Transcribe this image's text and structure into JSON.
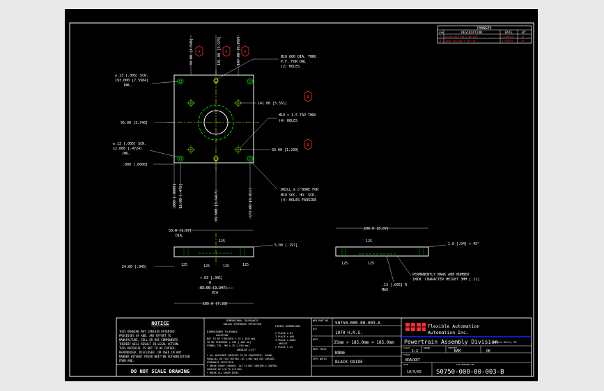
{
  "changes": {
    "title": "CHANGES",
    "headers": [
      "SYM",
      "DESCRIPTION",
      "DATE",
      "BY"
    ],
    "rows": [
      [
        "1",
        "REVISE HOLE DIM & ADD NOTE",
        "11/09/05",
        "JR"
      ],
      [
        "2",
        "ADDED BALLOONS & TEXT ON",
        "11/09/05",
        "JR"
      ]
    ]
  },
  "top_view": {
    "dim_v_left": "39.00 [1.536]",
    "dim_v_mid": "101.00 [3.976]",
    "dim_v_right": "147.00 [5.787]",
    "balloon_a": "A",
    "balloon_b": "B",
    "note_hole_1": "Ø10.000 DIA. THRU",
    "note_hole_2": "P.F. FOR DWL",
    "note_hole_3": "(2) HOLES",
    "bolt_scr_1": "±.13 [.005] SCR.",
    "bolt_scr_2": "193.000 [7.5984]",
    "bolt_scr_3": "DWL.",
    "dim_141": "141.00 [5.551]",
    "tap_1": "M10 × 1.5 TAP THRU",
    "tap_2": "(4) HOLES",
    "dim_95": "95.00 [3.740]",
    "scr2_1": "±.13 [.005] SCR.",
    "scr2_2": "12.000 [.4724]",
    "scr2_3": "DWL.",
    "dim_33": "33.00 [1.299]",
    "dim_000": ".000 [.0000]",
    "drill_1": "DRILL & C'BORE FOR",
    "drill_2": "M10 SOC. HD. SCR.",
    "drill_3": "(4) HOLES FARSIDE",
    "vb_1": ".000 [.0000]",
    "vb_2": "12.00 [.472]",
    "vb_3": "93.500 [3.6417]",
    "vb_4": "173.00 [6.811]"
  },
  "front_view": {
    "dim_dia_1": "50.0 [1.97]",
    "dim_dia_2": "DIA.",
    "dim_t": "5.00 [.197]",
    "dim_h": "24.00 [.945]",
    "s125": "125",
    "s125b": "125",
    "tol_1": "+.03 [.001]",
    "tol_2": "-0",
    "dim_85": "85.00 [3.347]",
    "dim_85b": "DIA",
    "dim_185": "185.0 [7.28]"
  },
  "side_view": {
    "dim_206": "206.0 [8.07]",
    "chamfer": "1.0 [.04] × 45°",
    "s125": "125",
    "mark_1": "PERMANENTLY MARK ABB NUMBER",
    "mark_2": "(MIN. CHARACTER HEIGHT 3MM [.12]",
    "rad_1": ".13 [.005] R",
    "rad_2": "MAX"
  },
  "title_block": {
    "notice_title": "NOTICE",
    "notice_lines": [
      "THIS DRAWING MAY CONTAIN PATENTED",
      "PROCESSES OF ABB. ANY EFFORT TO",
      "MANUFACTURE, SELL OR USE COMPONENTS",
      "THEREOF WILL RESULT IN LEGAL ACTION.",
      "THIS MATERIAL IS NOT TO BE COPIED,",
      "REPRODUCED, DISCLOSED, OR USED IN ANY",
      "MANNER WITHOUT PRIOR WRITTEN AUTHORIZATION",
      "FROM ABB."
    ],
    "do_not_scale": "DO NOT SCALE DRAWING",
    "tol_head_1": "DIMENSIONAL TOLERANCES",
    "tol_head_2": "UNLESS OTHERWISE SPECIFIED",
    "tol_lines": [
      "DIMENSIONED TOLERANCE",
      "LOCATION",
      "NOT TO BE FINISHED  ±.25 [.010 mm]",
      "TO BE FINISHED  ±.130 [.005 mm]",
      "SYMBOL TOL. MM  ±.25 [.010 mm]",
      "ANGULAR  ±1/2°"
    ],
    "finish_head": "FINISH DIMENSIONS",
    "finish_lines": [
      "2 PLACE ±.01",
      "3 PLACE ±.005",
      "4 PLACE ±.0005",
      "ANGLES",
      "2 PLACE ±.25"
    ],
    "notes_lines": [
      "* ALL MACHINED SURFACES TO BE CONCENTRIC, ROUND,",
      "  PARALLEL OR FLAT WITHIN .03 [.001 mm] USE VARIOUS",
      "  OTHERWISE SPECIFIED.",
      "* BREAK SHARP CORNERS .5x1 TO NOT CONFIRM & CONTROL",
      "  SURFACE OK 1/8 TO 3/8 MAX.",
      "* BREAK ALL SHARP EDGES"
    ],
    "labels": [
      "WEB PART NO.",
      "QTY",
      "MATL",
      "HEAT TREAT",
      "SPEC NOTES"
    ],
    "part_no": "S0750-000-00-003-A",
    "material": "1070 H.R.S.",
    "size": "25mm × 185.0mm × 185.0mm",
    "heat_treat": "NONE",
    "spec_notes": "BLACK OXIDE",
    "company_1": "Flexible Automation",
    "company_2": "Automation Inc.",
    "division": "Powertrain Assembly Division",
    "location": "Auburn Hills, MI",
    "scale_label": "SCALE",
    "scale": "1:2",
    "drawn_label": "DRAWN",
    "drawn": "NAM",
    "checked_label": "CHECKED",
    "checked": "OK",
    "title_label": "TITLE",
    "title": "BRACKET",
    "date_label": "DATE",
    "date": "10/9/05",
    "dwg_label": "CAD DRAWING NO.",
    "dwg_no": "S0750-000-00-003-B"
  },
  "colors": {
    "background": "#000000",
    "line": "#ffffff",
    "green": "#00cc00",
    "red": "#ff2a2a",
    "yellow": "#ffff00",
    "cyan": "#00ffff",
    "blue": "#2020ff"
  }
}
